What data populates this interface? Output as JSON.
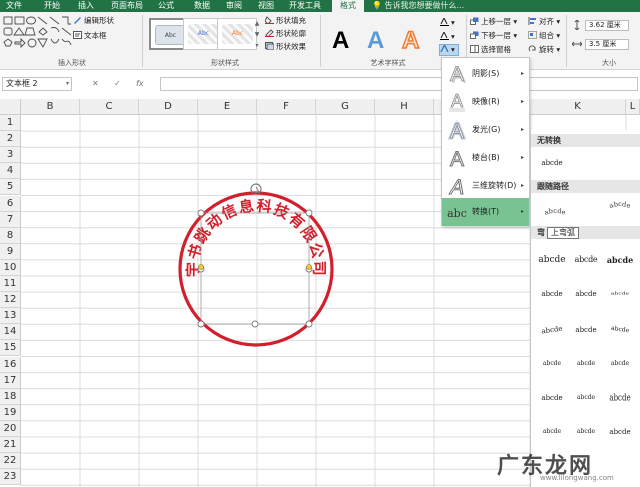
{
  "tabs": [
    {
      "label": "文件"
    },
    {
      "label": "开始"
    },
    {
      "label": "插入"
    },
    {
      "label": "页面布局"
    },
    {
      "label": "公式"
    },
    {
      "label": "数据"
    },
    {
      "label": "审阅"
    },
    {
      "label": "视图"
    },
    {
      "label": "开发工具"
    },
    {
      "label": "格式"
    }
  ],
  "tell_me": "告诉我您想要做什么...",
  "ribbon": {
    "insert_shapes": {
      "label": "插入形状",
      "edit_shape": "编辑形状",
      "text_box": "文本框"
    },
    "shape_styles": {
      "label": "形状样式",
      "thumb_label": "Abc",
      "fill": "形状填充",
      "outline": "形状轮廓",
      "effects": "形状效果"
    },
    "wordart": {
      "label": "艺术字样式",
      "sample": "A"
    },
    "arrange": {
      "bring_forward": "上移一层",
      "send_backward": "下移一层",
      "selection_pane": "选择窗格",
      "align": "对齐",
      "group": "组合",
      "rotate": "旋转"
    },
    "size": {
      "label": "大小",
      "height": "3.62 厘米",
      "width": "3.5 厘米"
    }
  },
  "formula_bar": {
    "name_box": "文本框 2",
    "cancel": "✕",
    "confirm": "✓",
    "fx": "fx",
    "value": ""
  },
  "columns": [
    "B",
    "C",
    "D",
    "E",
    "F",
    "G",
    "H",
    "K",
    "L"
  ],
  "rows": [
    "1",
    "2",
    "3",
    "4",
    "5",
    "6",
    "7",
    "8",
    "9",
    "10",
    "11",
    "12",
    "13",
    "14",
    "15",
    "16",
    "17",
    "18",
    "19",
    "20",
    "21",
    "22",
    "23"
  ],
  "seal": {
    "text": "宇书跳动信息科技有限公司",
    "color": "#d21f2b"
  },
  "text_effects_menu": [
    {
      "label": "阴影(S)",
      "icon": "shadow-icon"
    },
    {
      "label": "映像(R)",
      "icon": "reflection-icon"
    },
    {
      "label": "发光(G)",
      "icon": "glow-icon"
    },
    {
      "label": "棱台(B)",
      "icon": "bevel-icon"
    },
    {
      "label": "三维旋转(D)",
      "icon": "3d-rotation-icon"
    },
    {
      "label": "转换(T)",
      "icon": "transform-icon",
      "highlighted": true
    }
  ],
  "transform_gallery": {
    "no_transform": "无转换",
    "no_transform_sample": "abcde",
    "follow_path": "跟随路径",
    "warp": "弯曲",
    "warp_visible": "弯",
    "tooltip": "上弯弧",
    "sample": "abcde"
  },
  "watermark": {
    "text": "广东龙网",
    "url": "www.lilongwang.com"
  },
  "colors": {
    "excel_green": "#217346",
    "highlight": "#79c392",
    "seal_red": "#d21f2b"
  }
}
